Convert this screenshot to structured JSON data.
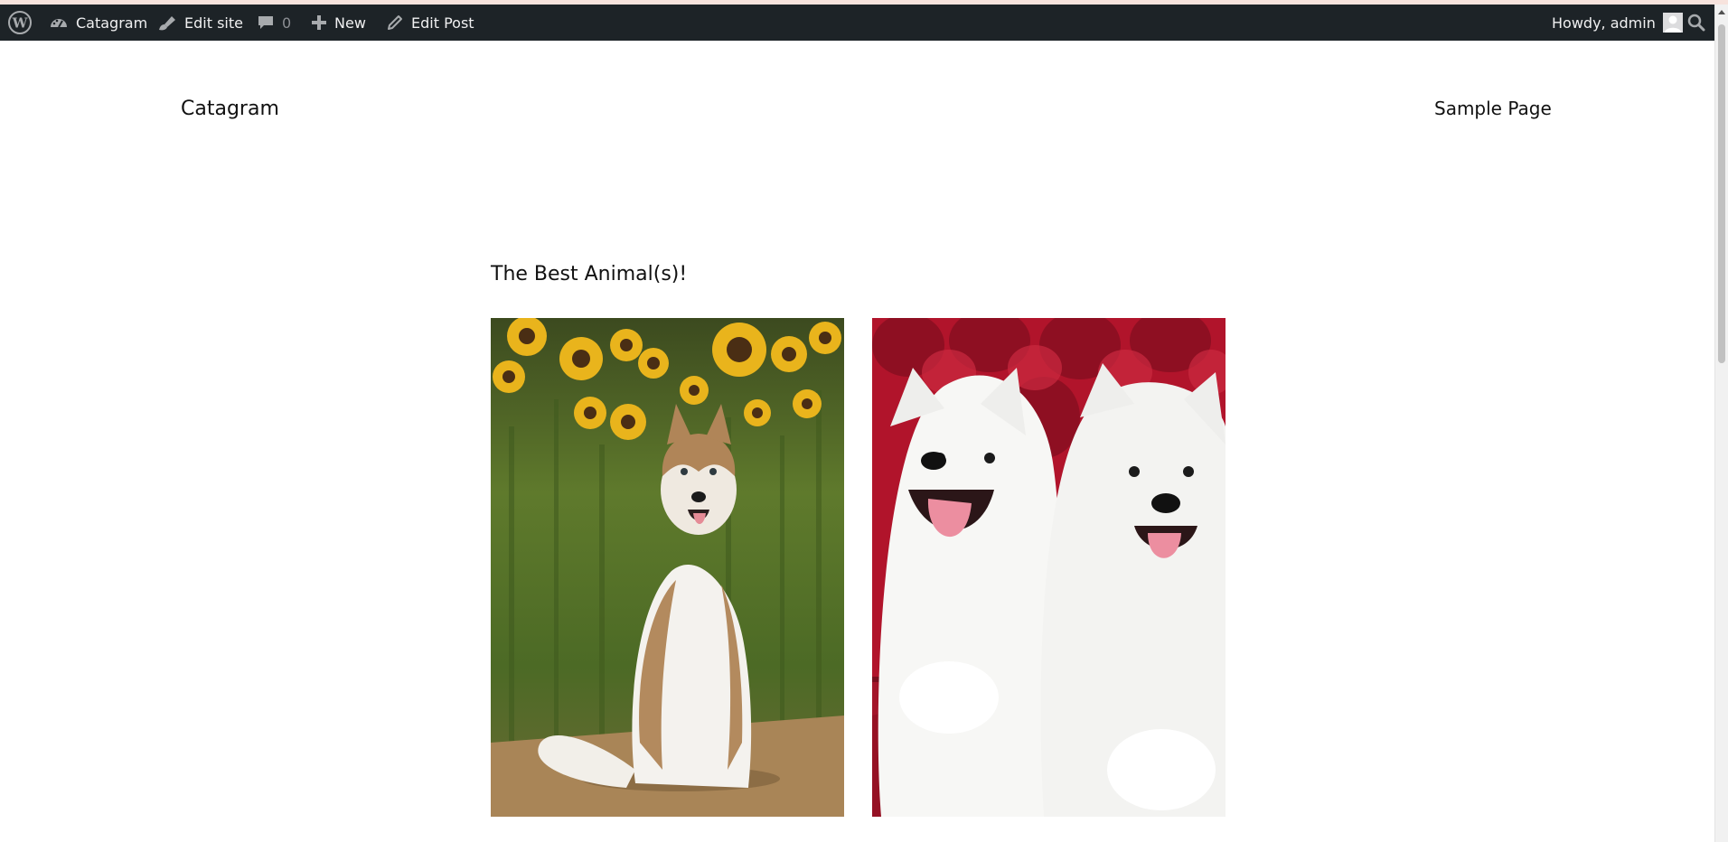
{
  "admin_bar": {
    "site_name": "Catagram",
    "edit_site": "Edit site",
    "comments_count": "0",
    "new_label": "New",
    "edit_post": "Edit Post",
    "howdy": "Howdy, admin"
  },
  "header": {
    "site_title": "Catagram",
    "nav_items": [
      "Sample Page"
    ]
  },
  "post": {
    "title": "The Best Animal(s)!",
    "gallery_images": [
      {
        "subject": "husky dog sitting in sunflower field"
      },
      {
        "subject": "two white samoyed puppies on red velvet couch"
      }
    ]
  },
  "colors": {
    "admin_bar_bg": "#1d2327",
    "admin_bar_text": "#f0f0f1",
    "page_bg": "#ffffff"
  },
  "icons": [
    "wordpress-logo-icon",
    "dashboard-icon",
    "brush-icon",
    "comment-icon",
    "plus-icon",
    "pencil-icon",
    "avatar-icon",
    "search-icon"
  ]
}
